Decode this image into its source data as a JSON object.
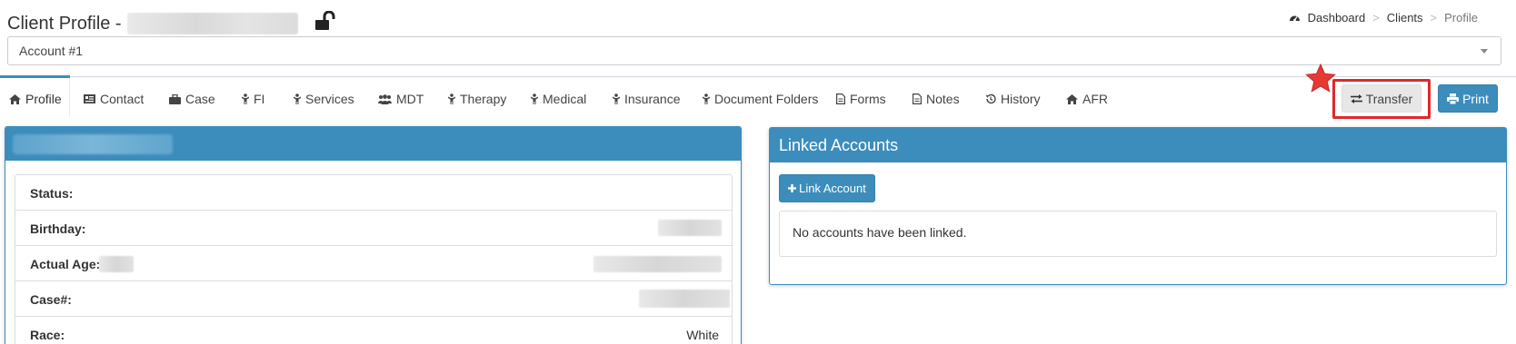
{
  "header": {
    "title": "Client Profile -",
    "breadcrumb": {
      "dashboard": "Dashboard",
      "sep1": ">",
      "clients": "Clients",
      "sep2": ">",
      "profile": "Profile"
    }
  },
  "account_select": {
    "value": "Account #1"
  },
  "tabs": [
    {
      "label": "Profile",
      "icon": "home-icon",
      "active": true
    },
    {
      "label": "Contact",
      "icon": "address-card-icon"
    },
    {
      "label": "Case",
      "icon": "briefcase-icon"
    },
    {
      "label": "FI",
      "icon": "child-icon"
    },
    {
      "label": "Services",
      "icon": "child-icon"
    },
    {
      "label": "MDT",
      "icon": "users-icon"
    },
    {
      "label": "Therapy",
      "icon": "child-icon"
    },
    {
      "label": "Medical",
      "icon": "child-icon"
    },
    {
      "label": "Insurance",
      "icon": "child-icon"
    },
    {
      "label": "Document Folders",
      "icon": "child-icon"
    },
    {
      "label": "Forms",
      "icon": "file-icon"
    },
    {
      "label": "Notes",
      "icon": "file-icon"
    },
    {
      "label": "History",
      "icon": "history-icon"
    },
    {
      "label": "AFR",
      "icon": "home-icon"
    }
  ],
  "actions": {
    "transfer": "Transfer",
    "print": "Print"
  },
  "profile_panel": {
    "rows": [
      {
        "label": "Status:",
        "value": ""
      },
      {
        "label": "Birthday:",
        "value": ""
      },
      {
        "label": "Actual Age:",
        "value": ""
      },
      {
        "label": "Case#:",
        "value": ""
      },
      {
        "label": "Race:",
        "value": "White"
      }
    ]
  },
  "linked_accounts": {
    "title": "Linked Accounts",
    "link_button": "Link Account",
    "empty_message": "No accounts have been linked."
  },
  "colors": {
    "primary": "#3c8dbc",
    "highlight": "#e0282b",
    "star": "#e53935"
  }
}
